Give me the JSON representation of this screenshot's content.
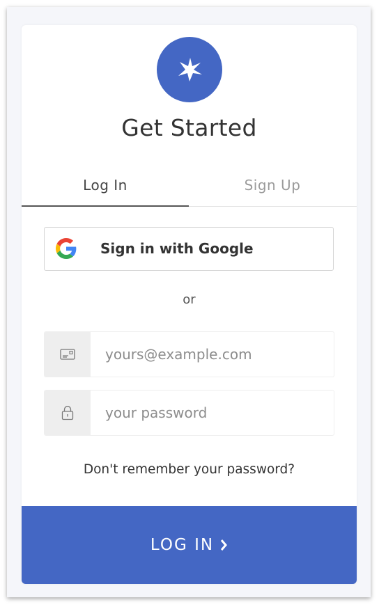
{
  "colors": {
    "brand": "#4467c4",
    "text": "#333333",
    "muted": "#9b9b9b"
  },
  "header": {
    "logo_icon": "starburst-icon",
    "title": "Get Started"
  },
  "tabs": [
    {
      "label": "Log In",
      "active": true
    },
    {
      "label": "Sign Up",
      "active": false
    }
  ],
  "social": {
    "google_icon": "google-icon",
    "google_label": "Sign in with Google"
  },
  "divider_text": "or",
  "form": {
    "email": {
      "icon": "envelope-icon",
      "placeholder": "yours@example.com",
      "value": ""
    },
    "password": {
      "icon": "lock-icon",
      "placeholder": "your password",
      "value": ""
    }
  },
  "forgot_link": "Don't remember your password?",
  "submit": {
    "label": "LOG IN",
    "icon": "chevron-right-icon"
  }
}
